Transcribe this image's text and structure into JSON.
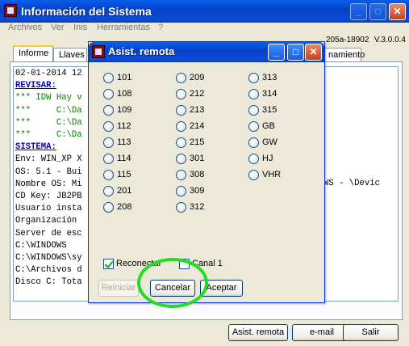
{
  "main": {
    "title": "Información del Sistema",
    "menu": [
      "Archivos",
      "Ver",
      "Inis",
      "Herramientas",
      "?"
    ],
    "version_part": "205a-18902",
    "version": "V.3.0.0.4",
    "tabs": [
      "Informe",
      "Llaves",
      "namiento"
    ],
    "lines": [
      {
        "text": "02-01-2014 12",
        "style": "normal"
      },
      {
        "text": "REVISAR:",
        "style": "blue"
      },
      {
        "text": "*** IDW Hay v",
        "style": "green"
      },
      {
        "text": "***     C:\\Da",
        "style": "green"
      },
      {
        "text": "***     C:\\Da",
        "style": "green"
      },
      {
        "text": "***     C:\\Da",
        "style": "green"
      },
      {
        "text": "SISTEMA:",
        "style": "blue"
      },
      {
        "text": "Env: WIN_XP X",
        "style": "normal"
      },
      {
        "text": "OS: 5.1 - Bui",
        "style": "normal"
      },
      {
        "text": "Nombre OS: Mi",
        "style": "normal"
      },
      {
        "text": "CD Key: JB2PB",
        "style": "normal"
      },
      {
        "text": "Usuario insta",
        "style": "normal"
      },
      {
        "text": "Organización",
        "style": "normal"
      },
      {
        "text": "Server de esc",
        "style": "normal"
      },
      {
        "text": "C:\\WINDOWS",
        "style": "normal"
      },
      {
        "text": "C:\\WINDOWS\\sy",
        "style": "normal"
      },
      {
        "text": "C:\\Archivos d",
        "style": "normal"
      },
      {
        "text": "Disco C: Tota",
        "style": "normal"
      }
    ],
    "right_text": "WS - \\Devic",
    "buttons": {
      "remote": "Asist. remota",
      "email": "e-mail",
      "exit": "Salir"
    }
  },
  "dialog": {
    "title": "Asist. remota",
    "options": [
      [
        "101",
        "108",
        "109",
        "112",
        "113",
        "114",
        "115",
        "201",
        "208"
      ],
      [
        "209",
        "212",
        "213",
        "214",
        "215",
        "301",
        "308",
        "309",
        "312"
      ],
      [
        "313",
        "314",
        "315",
        "GB",
        "GW",
        "HJ",
        "VHR"
      ]
    ],
    "reconnect_label": "Reconectar",
    "reconnect_checked": true,
    "channel_label": "Canal 1",
    "channel_checked": false,
    "buttons": {
      "restart": "Reiniciar",
      "cancel": "Cancelar",
      "accept": "Aceptar"
    }
  },
  "colors": {
    "highlight_circle": "#22dd22",
    "title_blue": "#0642c8"
  }
}
